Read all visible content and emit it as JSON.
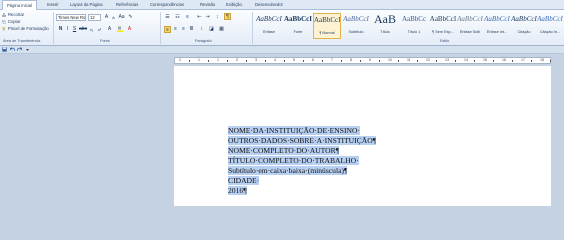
{
  "tabs": [
    {
      "label": "Página Inicial",
      "active": true
    },
    {
      "label": "Inserir"
    },
    {
      "label": "Layout da Página"
    },
    {
      "label": "Referências"
    },
    {
      "label": "Correspondências"
    },
    {
      "label": "Revisão"
    },
    {
      "label": "Exibição"
    },
    {
      "label": "Desenvolvedor"
    }
  ],
  "clipboard": {
    "items": [
      "Recortar",
      "Copiar",
      "Pincel de Formatação"
    ],
    "group_label": "Área de Transferência"
  },
  "font": {
    "name": "Times New Ro",
    "size": "12",
    "group_label": "Fonte"
  },
  "paragraph": {
    "group_label": "Parágrafo"
  },
  "styles": {
    "group_label": "Estilo",
    "items": [
      {
        "preview": "AaBbCcI",
        "name": "Ênfase"
      },
      {
        "preview": "AaBbCcI",
        "name": "Forte"
      },
      {
        "preview": "AaBbCcI",
        "name": "¶ Normal",
        "selected": true
      },
      {
        "preview": "AaBbCcI",
        "name": "Subtítulo"
      },
      {
        "preview": "AaB",
        "name": "Título"
      },
      {
        "preview": "AaBbCc",
        "name": "Título 1"
      },
      {
        "preview": "AaBbCcI",
        "name": "¶ Sem Esp..."
      },
      {
        "preview": "AaBbCcI",
        "name": "Ênfase Sutil"
      },
      {
        "preview": "AaBbCcI",
        "name": "Ênfase Int..."
      },
      {
        "preview": "AaBbCcI",
        "name": "Citação"
      },
      {
        "preview": "AaBbCcI",
        "name": "Citação In..."
      }
    ]
  },
  "ruler": {
    "labels": [
      "2",
      "1",
      "1",
      "2",
      "3",
      "4",
      "5",
      "6",
      "7",
      "8",
      "9",
      "10",
      "11",
      "12",
      "13",
      "14",
      "15",
      "16",
      "17",
      "18"
    ]
  },
  "document": {
    "lines": [
      "NOME·DA·INSTITUIÇÃO·DE·ENSINO·",
      "OUTROS·DADOS·SOBRE·A·INSTITUIÇÃO¶",
      "NOME·COMPLETO·DO·AUTOR¶",
      "TÍTULO·COMPLETO·DO·TRABALHO·",
      "Subtítulo·em·caixa·baixa·(minúscula)¶",
      "CIDADE·",
      "2016¶"
    ]
  }
}
